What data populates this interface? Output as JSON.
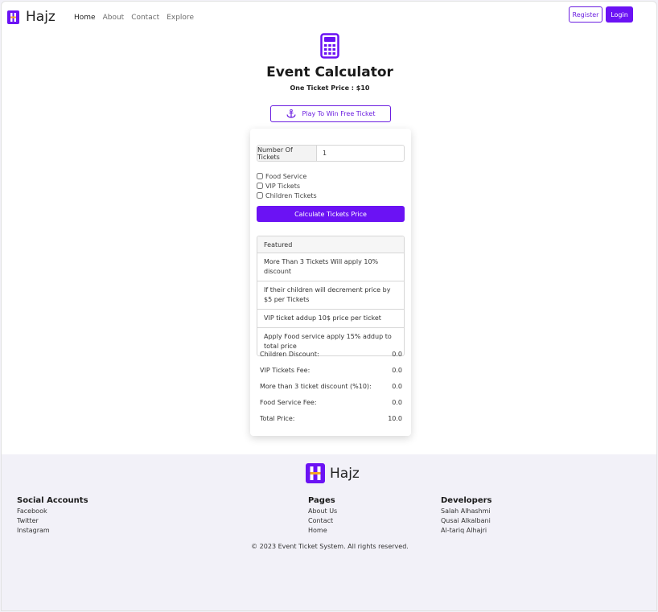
{
  "brand": {
    "name": "Hajz",
    "accent": "#6b12f4",
    "logo_bg": "#6b12f4",
    "logo_stripe": "#f5a623"
  },
  "nav": {
    "links": [
      "Home",
      "About",
      "Contact",
      "Explore"
    ],
    "register": "Register",
    "login": "Login"
  },
  "hero": {
    "icon": "calculator-icon",
    "title": "Event Calculator",
    "price_line": "One Ticket Price : $10",
    "play_button": "Play To Win Free Ticket"
  },
  "form": {
    "tickets_label": "Number Of Tickets",
    "tickets_value": "1",
    "options": [
      "Food Service",
      "VIP Tickets",
      "Children Tickets"
    ],
    "calculate_button": "Calculate Tickets Price"
  },
  "featured": {
    "header": "Featured",
    "items": [
      "More Than 3 Tickets Will apply 10% discount",
      "If their children will decrement price by $5 per Tickets",
      "VIP ticket addup 10$ price per ticket",
      "Apply Food service apply 15% addup to total price"
    ]
  },
  "results": [
    {
      "label": "Children Discount:",
      "value": "0.0"
    },
    {
      "label": "VIP Tickets Fee:",
      "value": "0.0"
    },
    {
      "label": "More than 3 ticket discount (%10):",
      "value": "0.0"
    },
    {
      "label": "Food Service Fee:",
      "value": "0.0"
    },
    {
      "label": "Total Price:",
      "value": "10.0"
    }
  ],
  "footer": {
    "brand": "Hajz",
    "social": {
      "title": "Social Accounts",
      "links": [
        "Facebook",
        "Twitter",
        "Instagram"
      ]
    },
    "pages": {
      "title": "Pages",
      "links": [
        "About Us",
        "Contact",
        "Home"
      ]
    },
    "developers": {
      "title": "Developers",
      "names": [
        "Salah Alhashmi",
        "Qusai Alkalbani",
        "Al-tariq Alhajri"
      ]
    },
    "copyright": "© 2023 Event Ticket System. All rights reserved."
  }
}
